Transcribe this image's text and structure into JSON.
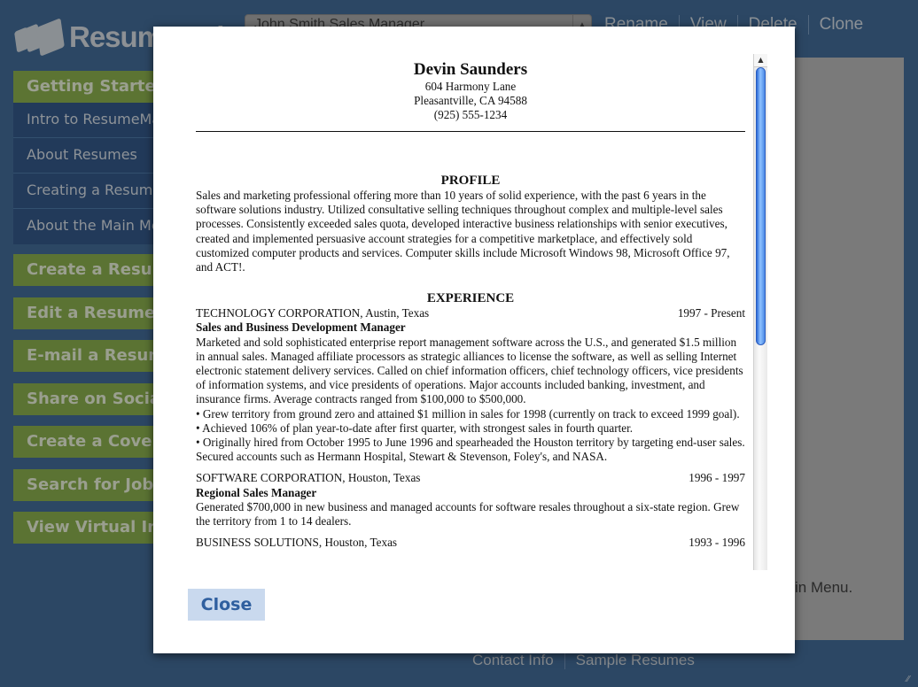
{
  "header": {
    "logo_text": "ResumeMaker",
    "resume_select_value": "John Smith Sales Manager",
    "actions": [
      "Rename",
      "View",
      "Delete",
      "Clone"
    ]
  },
  "sidebar": {
    "section_title": "Getting Started",
    "sub_items": [
      "Intro to ResumeMaker",
      "About Resumes",
      "Creating a Resume",
      "About the Main Menu"
    ],
    "buttons": [
      "Create a Resume",
      "Edit a Resume",
      "E-mail a Resume",
      "Share on Social Media",
      "Create a Cover Letter",
      "Search for Jobs",
      "View Virtual Interview"
    ]
  },
  "content": {
    "tail_text": "in Menu."
  },
  "footer": {
    "links": [
      "Contact Info",
      "Sample Resumes"
    ]
  },
  "modal": {
    "close_label": "Close",
    "resume": {
      "name": "Devin Saunders",
      "address": "604 Harmony Lane",
      "city": "Pleasantville, CA 94588",
      "phone": "(925) 555-1234",
      "profile_title": "PROFILE",
      "profile_text": "Sales and marketing professional offering more than 10 years of solid experience, with the past 6 years in the software solutions industry. Utilized consultative selling techniques throughout complex and multiple-level sales processes. Consistently exceeded sales quota, developed interactive business relationships with senior executives, created and implemented persuasive account strategies for a competitive marketplace, and effectively sold customized computer products and services. Computer skills include Microsoft Windows 98, Microsoft Office 97, and ACT!.",
      "experience_title": "EXPERIENCE",
      "jobs": [
        {
          "company": "TECHNOLOGY CORPORATION, Austin, Texas",
          "dates": "1997 - Present",
          "title": "Sales and Business Development Manager",
          "description": "Marketed and sold sophisticated enterprise report management software across the U.S., and generated $1.5 million in annual sales. Managed affiliate processors as strategic alliances to license the software, as well as selling Internet electronic statement delivery services. Called on chief information officers, chief technology officers, vice presidents of information systems, and vice presidents of operations. Major accounts included banking, investment, and insurance firms. Average contracts ranged from $100,000 to $500,000.",
          "bullets": [
            "• Grew territory from ground zero and attained $1 million in sales for 1998 (currently on track to exceed 1999 goal).",
            "• Achieved 106% of plan year-to-date after first quarter, with strongest sales in fourth quarter.",
            "• Originally hired from October 1995 to June 1996 and spearheaded the Houston territory by targeting end-user sales. Secured accounts such as Hermann Hospital, Stewart & Stevenson, Foley's, and NASA."
          ]
        },
        {
          "company": "SOFTWARE CORPORATION, Houston, Texas",
          "dates": "1996 - 1997",
          "title": "Regional Sales Manager",
          "description": "Generated $700,000 in new business and managed accounts for software resales throughout a six-state region. Grew the territory from 1 to 14 dealers.",
          "bullets": []
        },
        {
          "company": "BUSINESS SOLUTIONS, Houston, Texas",
          "dates": "1993 - 1996",
          "title": "",
          "description": "",
          "bullets": []
        }
      ]
    }
  },
  "colors": {
    "background": "#2c4764",
    "sidebar_green_dimmed": "#5b7333",
    "close_button_bg": "#c9d9ee",
    "close_button_text": "#2f5f9f"
  }
}
